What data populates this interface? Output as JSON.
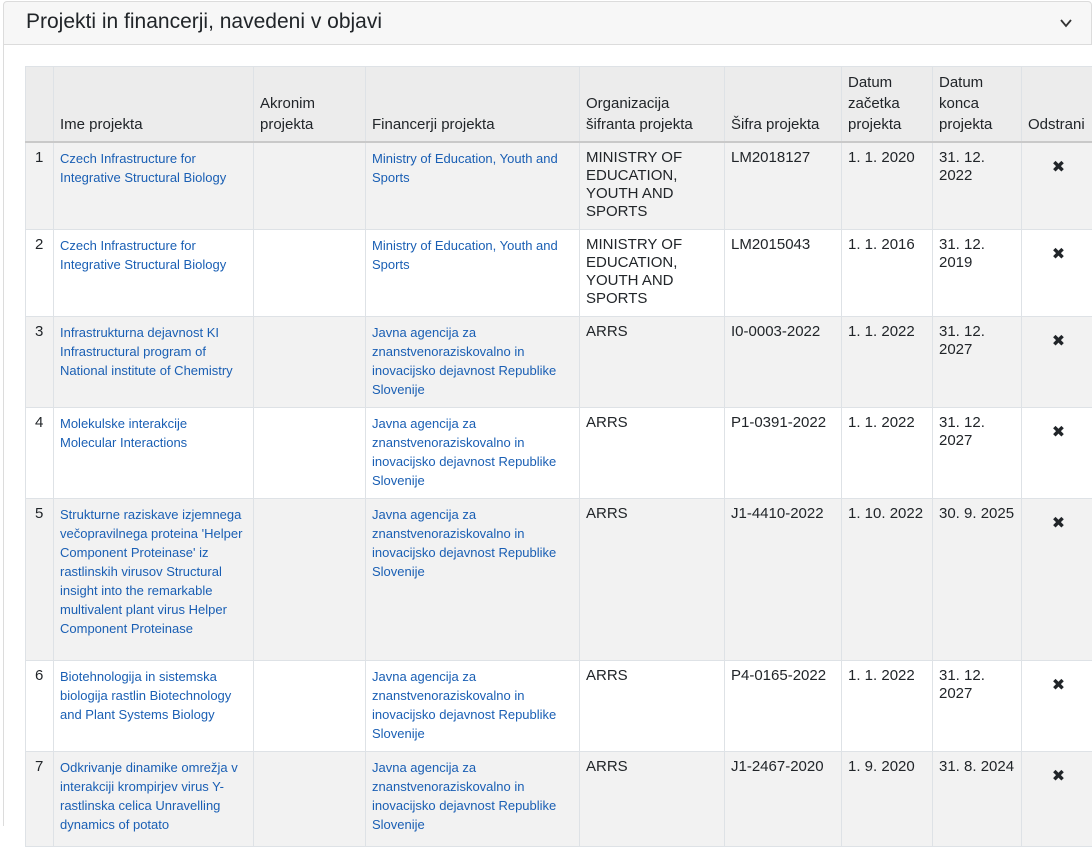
{
  "panel": {
    "title": "Projekti in financerji, navedeni v objavi",
    "collapse_icon": "chevron-down-icon"
  },
  "table": {
    "headers": {
      "num": "",
      "name": "Ime projekta",
      "acronym": "Akronim projekta",
      "funders": "Financerji projekta",
      "org": "Organizacija šifranta projekta",
      "code": "Šifra projekta",
      "start": "Datum začetka projekta",
      "end": "Datum konca projekta",
      "remove": "Odstrani"
    },
    "remove_symbol": "✖",
    "rows": [
      {
        "num": "1",
        "name": "Czech Infrastructure for Integrative Structural Biology",
        "acronym": "",
        "funder": "Ministry of Education, Youth and Sports",
        "org": "MINISTRY OF EDUCATION, YOUTH AND SPORTS",
        "code": "LM2018127",
        "start": "1. 1. 2020",
        "end": "31. 12. 2022"
      },
      {
        "num": "2",
        "name": "Czech Infrastructure for Integrative Structural Biology",
        "acronym": "",
        "funder": "Ministry of Education, Youth and Sports",
        "org": "MINISTRY OF EDUCATION, YOUTH AND SPORTS",
        "code": "LM2015043",
        "start": "1. 1. 2016",
        "end": "31. 12. 2019"
      },
      {
        "num": "3",
        "name": "Infrastrukturna dejavnost KI Infrastructural program of National institute of Chemistry",
        "acronym": "",
        "funder": "Javna agencija za znanstvenoraziskovalno in inovacijsko dejavnost Republike Slovenije",
        "org": "ARRS",
        "code": "I0-0003-2022",
        "start": "1. 1. 2022",
        "end": "31. 12. 2027"
      },
      {
        "num": "4",
        "name": "Molekulske interakcije Molecular Interactions",
        "acronym": "",
        "funder": "Javna agencija za znanstvenoraziskovalno in inovacijsko dejavnost Republike Slovenije",
        "org": "ARRS",
        "code": "P1-0391-2022",
        "start": "1. 1. 2022",
        "end": "31. 12. 2027"
      },
      {
        "num": "5",
        "name": "Strukturne raziskave izjemnega večopravilnega proteina 'Helper Component Proteinase' iz rastlinskih virusov Structural insight into the remarkable multivalent plant virus Helper Component Proteinase",
        "acronym": "",
        "funder": "Javna agencija za znanstvenoraziskovalno in inovacijsko dejavnost Republike Slovenije",
        "org": "ARRS",
        "code": "J1-4410-2022",
        "start": "1. 10. 2022",
        "end": "30. 9. 2025"
      },
      {
        "num": "6",
        "name": "Biotehnologija in sistemska biologija rastlin Biotechnology and Plant Systems Biology",
        "acronym": "",
        "funder": "Javna agencija za znanstvenoraziskovalno in inovacijsko dejavnost Republike Slovenije",
        "org": "ARRS",
        "code": "P4-0165-2022",
        "start": "1. 1. 2022",
        "end": "31. 12. 2027"
      },
      {
        "num": "7",
        "name": "Odkrivanje dinamike omrežja v interakciji krompirjev virus Y- rastlinska celica Unravelling dynamics of potato",
        "acronym": "",
        "funder": "Javna agencija za znanstvenoraziskovalno in inovacijsko dejavnost Republike Slovenije",
        "org": "ARRS",
        "code": "J1-2467-2020",
        "start": "1. 9. 2020",
        "end": "31. 8. 2024"
      }
    ]
  }
}
